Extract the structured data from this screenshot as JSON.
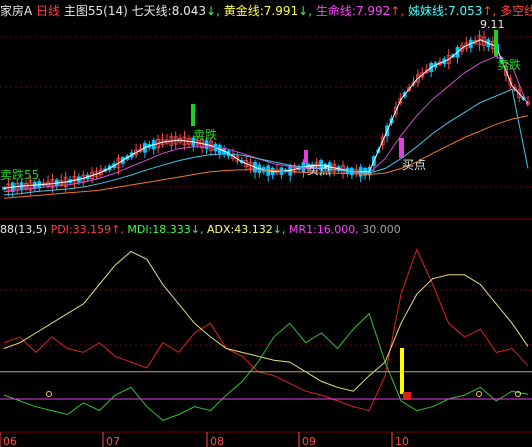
{
  "colors": {
    "background": "#000000",
    "grid_red": "#7a0000",
    "up_candle": "#ff4a4a",
    "down_candle": "#00c8ff",
    "ma_white": "#ffffff",
    "ma_yellow": "#f5e05a",
    "ma_magenta": "#d050d0",
    "ma_cyan": "#40c8e8",
    "ma_orange": "#f07830",
    "pdi": "#e02020",
    "mdi": "#30c030",
    "adx": "#e8e080",
    "mr1_line": "#e040e0",
    "level_30": "#b0b060",
    "signal_yellow": "#ffff00",
    "marker_green": "#20d020",
    "marker_magenta": "#e040e0",
    "text_red": "#ff4040",
    "text_green": "#40ff40",
    "text_yellow": "#ffff40",
    "text_white": "#e8e8e8",
    "text_magenta": "#ff40ff",
    "text_cyan": "#40ffff",
    "text_gray": "#a0a0a0"
  },
  "header": {
    "symbol_fragment": "家房A",
    "period": "日线",
    "chart_name": "主图55",
    "chart_param": "(14)",
    "ma7_label": "七天线:",
    "ma7_value": "8.043",
    "ma7_arrow": "↓,",
    "gold_label": "黄金线:",
    "gold_value": "7.991",
    "gold_arrow": "↓,",
    "life_label": "生命线:",
    "life_value": "7.992",
    "life_arrow": "↑,",
    "sister_label": "姊妹线:",
    "sister_value": "7.053",
    "sister_arrow": "↑,",
    "bullbear_label": "多空线"
  },
  "main_chart": {
    "price_high_label": "9.11",
    "annotations": [
      {
        "text": "卖跌",
        "kind": "sell"
      },
      {
        "text": "买点",
        "kind": "buy"
      },
      {
        "text": "买点",
        "kind": "buy"
      },
      {
        "text": "卖跌",
        "kind": "sell"
      },
      {
        "text": "卖跌55",
        "kind": "sell"
      }
    ]
  },
  "indicator": {
    "name": "88(13,5)",
    "pdi_label": "PDI:",
    "pdi_value": "33.159",
    "pdi_arrow": "↑,",
    "mdi_label": "MDI:",
    "mdi_value": "18.333",
    "mdi_arrow": "↓,",
    "adx_label": "ADX:",
    "adx_value": "43.132",
    "adx_arrow": "↓,",
    "mr1_label": "MR1:",
    "mr1_value": "16.000,",
    "level_value": "30.000"
  },
  "x_axis": [
    "06",
    "07",
    "08",
    "09",
    "10"
  ],
  "chart_data": [
    {
      "type": "line",
      "title": "主图55",
      "series": [
        {
          "name": "七天线",
          "values": [
            6.75,
            6.78,
            6.8,
            6.82,
            6.85,
            6.9,
            6.98,
            7.1,
            7.25,
            7.38,
            7.45,
            7.48,
            7.45,
            7.4,
            7.3,
            7.15,
            7.05,
            7.0,
            7.02,
            7.08,
            7.1,
            7.05,
            7.0,
            7.0,
            7.55,
            8.1,
            8.4,
            8.6,
            8.7,
            8.9,
            9.0,
            8.9,
            8.3,
            8.04
          ]
        },
        {
          "name": "生命线",
          "values": [
            6.7,
            6.73,
            6.75,
            6.78,
            6.8,
            6.84,
            6.9,
            6.98,
            7.08,
            7.18,
            7.28,
            7.35,
            7.38,
            7.38,
            7.35,
            7.28,
            7.2,
            7.12,
            7.08,
            7.05,
            7.05,
            7.03,
            7.0,
            6.98,
            7.2,
            7.55,
            7.85,
            8.1,
            8.3,
            8.5,
            8.65,
            8.75,
            8.6,
            7.99
          ]
        },
        {
          "name": "姊妹线",
          "values": [
            6.65,
            6.67,
            6.7,
            6.72,
            6.74,
            6.77,
            6.82,
            6.88,
            6.95,
            7.03,
            7.1,
            7.17,
            7.22,
            7.26,
            7.27,
            7.25,
            7.2,
            7.15,
            7.1,
            7.07,
            7.05,
            7.03,
            7.0,
            6.98,
            7.05,
            7.2,
            7.38,
            7.58,
            7.75,
            7.9,
            8.05,
            8.15,
            8.25,
            7.05
          ]
        },
        {
          "name": "多空线",
          "values": [
            6.6,
            6.62,
            6.64,
            6.66,
            6.68,
            6.7,
            6.72,
            6.76,
            6.8,
            6.84,
            6.88,
            6.92,
            6.96,
            7.0,
            7.02,
            7.03,
            7.03,
            7.02,
            7.0,
            6.99,
            6.98,
            6.98,
            6.97,
            6.96,
            6.98,
            7.05,
            7.15,
            7.28,
            7.4,
            7.52,
            7.62,
            7.72,
            7.8,
            7.85
          ]
        }
      ]
    },
    {
      "type": "line",
      "title": "88(13,5)",
      "ylim": [
        0,
        100
      ],
      "series": [
        {
          "name": "PDI",
          "values": [
            45,
            48,
            40,
            48,
            42,
            40,
            45,
            38,
            35,
            32,
            45,
            40,
            50,
            55,
            42,
            38,
            30,
            28,
            24,
            20,
            18,
            15,
            12,
            10,
            28,
            70,
            93,
            75,
            55,
            48,
            52,
            40,
            42,
            33.159
          ]
        },
        {
          "name": "MDI",
          "values": [
            18,
            15,
            12,
            10,
            8,
            14,
            10,
            18,
            22,
            12,
            5,
            8,
            12,
            10,
            18,
            25,
            35,
            48,
            55,
            45,
            50,
            42,
            52,
            60,
            35,
            15,
            10,
            12,
            16,
            18,
            22,
            15,
            20,
            18.333
          ]
        },
        {
          "name": "ADX",
          "values": [
            42,
            45,
            50,
            55,
            60,
            65,
            75,
            85,
            92,
            88,
            75,
            65,
            55,
            48,
            42,
            40,
            38,
            36,
            35,
            30,
            25,
            22,
            20,
            28,
            35,
            55,
            70,
            78,
            80,
            80,
            75,
            65,
            55,
            43.132
          ]
        },
        {
          "name": "MR1",
          "values": [
            16,
            16,
            16,
            16,
            16,
            16,
            16,
            16,
            16,
            16,
            16,
            16,
            16,
            16,
            16,
            16,
            16,
            16,
            16,
            16,
            16,
            16,
            16,
            16,
            16,
            16,
            16,
            16,
            16,
            16,
            16,
            16,
            16,
            16
          ]
        },
        {
          "name": "30.000",
          "values": [
            30,
            30,
            30,
            30,
            30,
            30,
            30,
            30,
            30,
            30,
            30,
            30,
            30,
            30,
            30,
            30,
            30,
            30,
            30,
            30,
            30,
            30,
            30,
            30,
            30,
            30,
            30,
            30,
            30,
            30,
            30,
            30,
            30,
            30
          ]
        }
      ]
    }
  ]
}
